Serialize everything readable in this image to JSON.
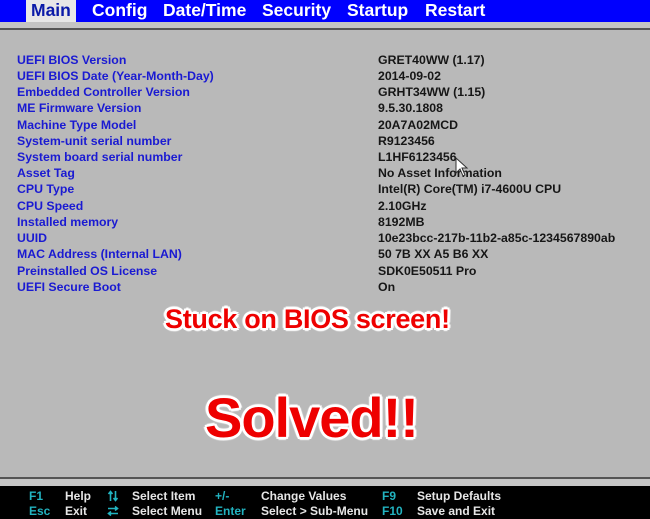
{
  "menu": {
    "tabs": [
      {
        "label": "Main",
        "active": true
      },
      {
        "label": "Config",
        "active": false
      },
      {
        "label": "Date/Time",
        "active": false
      },
      {
        "label": "Security",
        "active": false
      },
      {
        "label": "Startup",
        "active": false
      },
      {
        "label": "Restart",
        "active": false
      }
    ]
  },
  "info": [
    {
      "label": "UEFI BIOS Version",
      "value": "GRET40WW (1.17)"
    },
    {
      "label": "UEFI BIOS Date (Year-Month-Day)",
      "value": "2014-09-02"
    },
    {
      "label": "Embedded Controller Version",
      "value": "GRHT34WW (1.15)"
    },
    {
      "label": "ME Firmware Version",
      "value": "9.5.30.1808"
    },
    {
      "label": "Machine Type Model",
      "value": "20A7A02MCD"
    },
    {
      "label": "System-unit serial number",
      "value": "R9123456"
    },
    {
      "label": "System board serial number",
      "value": "L1HF6123456"
    },
    {
      "label": "Asset Tag",
      "value": "No Asset Information"
    },
    {
      "label": "CPU Type",
      "value": "Intel(R) Core(TM) i7-4600U CPU"
    },
    {
      "label": "CPU Speed",
      "value": "2.10GHz"
    },
    {
      "label": "Installed memory",
      "value": "8192MB"
    },
    {
      "label": "UUID",
      "value": "10e23bcc-217b-11b2-a85c-1234567890ab"
    },
    {
      "label": "MAC Address (Internal LAN)",
      "value": "50 7B XX A5 B6 XX"
    },
    {
      "label": "Preinstalled OS License",
      "value": "SDK0E50511 Pro"
    },
    {
      "label": "UEFI Secure Boot",
      "value": "On"
    }
  ],
  "overlay": {
    "headline": "Stuck on BIOS screen!",
    "result": "Solved!!"
  },
  "footer": {
    "row1": [
      {
        "key": "F1",
        "desc": "Help"
      },
      {
        "key": "up-down-arrows-icon",
        "desc": "Select Item"
      },
      {
        "key": "+/-",
        "desc": "Change Values"
      },
      {
        "key": "F9",
        "desc": "Setup Defaults"
      }
    ],
    "row2": [
      {
        "key": "Esc",
        "desc": "Exit"
      },
      {
        "key": "left-right-arrows-icon",
        "desc": "Select Menu"
      },
      {
        "key": "Enter",
        "desc": "Select > Sub-Menu"
      },
      {
        "key": "F10",
        "desc": "Save and Exit"
      }
    ]
  },
  "colors": {
    "menu_bar": "#0000fe",
    "label_text": "#1a1ad2",
    "value_text": "#161616",
    "background": "#b9b9b9",
    "footer_key": "#22b3c0",
    "overlay_red": "#ee0000"
  }
}
